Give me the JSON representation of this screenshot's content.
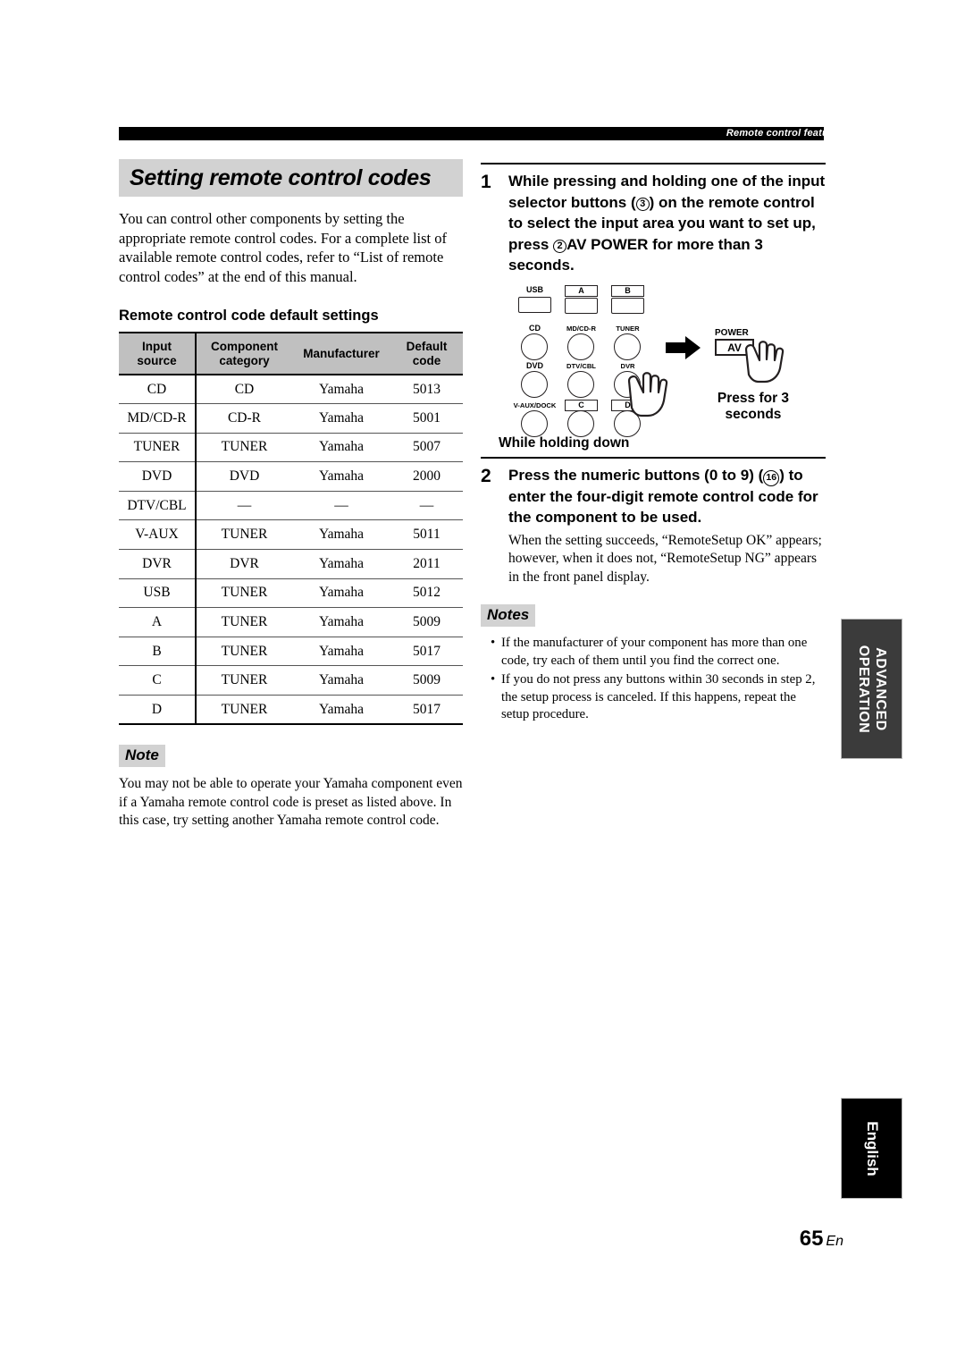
{
  "running_head": "Remote control features",
  "left": {
    "section_title": "Setting remote control codes",
    "intro": "You can control other components by setting the appropriate remote control codes. For a complete list of available remote control codes, refer to “List of remote control codes” at the end of this manual.",
    "table_heading": "Remote control code default settings",
    "table": {
      "columns": [
        {
          "line1": "Input",
          "line2": "source"
        },
        {
          "line1": "Component",
          "line2": "category"
        },
        {
          "line1": "Manufacturer",
          "line2": ""
        },
        {
          "line1": "Default",
          "line2": "code"
        }
      ],
      "rows": [
        {
          "input": "CD",
          "category": "CD",
          "manufacturer": "Yamaha",
          "code": "5013"
        },
        {
          "input": "MD/CD-R",
          "category": "CD-R",
          "manufacturer": "Yamaha",
          "code": "5001"
        },
        {
          "input": "TUNER",
          "category": "TUNER",
          "manufacturer": "Yamaha",
          "code": "5007"
        },
        {
          "input": "DVD",
          "category": "DVD",
          "manufacturer": "Yamaha",
          "code": "2000"
        },
        {
          "input": "DTV/CBL",
          "category": "—",
          "manufacturer": "—",
          "code": "—"
        },
        {
          "input": "V-AUX",
          "category": "TUNER",
          "manufacturer": "Yamaha",
          "code": "5011"
        },
        {
          "input": "DVR",
          "category": "DVR",
          "manufacturer": "Yamaha",
          "code": "2011"
        },
        {
          "input": "USB",
          "category": "TUNER",
          "manufacturer": "Yamaha",
          "code": "5012"
        },
        {
          "input": "A",
          "category": "TUNER",
          "manufacturer": "Yamaha",
          "code": "5009"
        },
        {
          "input": "B",
          "category": "TUNER",
          "manufacturer": "Yamaha",
          "code": "5017"
        },
        {
          "input": "C",
          "category": "TUNER",
          "manufacturer": "Yamaha",
          "code": "5009"
        },
        {
          "input": "D",
          "category": "TUNER",
          "manufacturer": "Yamaha",
          "code": "5017"
        }
      ]
    },
    "note": {
      "tag": "Note",
      "text": "You may not be able to operate your Yamaha component even if a Yamaha remote control code is preset as listed above. In this case, try setting another Yamaha remote control code."
    }
  },
  "right": {
    "step1": {
      "number": "1",
      "title_a": "While pressing and holding one of the input selector buttons (",
      "circ_3": "3",
      "title_b": ") on the remote control to select the input area you want to set up, press ",
      "circ_2": "2",
      "title_c": "AV POWER",
      "title_d": " for more than 3 seconds."
    },
    "diagram": {
      "row1": [
        {
          "label": "USB",
          "boxed": false
        },
        {
          "label": "A",
          "boxed": true
        },
        {
          "label": "B",
          "boxed": true
        }
      ],
      "row2": [
        "CD",
        "MD/CD-R",
        "TUNER"
      ],
      "row3": [
        "DVD",
        "DTV/CBL",
        "DVR"
      ],
      "row4": [
        {
          "label": "V-AUX/DOCK",
          "boxed": false
        },
        {
          "label": "C",
          "boxed": true
        },
        {
          "label": "D",
          "boxed": true
        }
      ],
      "caption_left": "While holding down",
      "power_label": "POWER",
      "av_label": "AV",
      "caption_right_line1": "Press for 3",
      "caption_right_line2": "seconds"
    },
    "step2": {
      "number": "2",
      "title_a": "Press the numeric buttons (0 to 9) (",
      "circ_16": "16",
      "title_b": ") to enter the four-digit remote control code for the component to be used.",
      "body": "When the setting succeeds, “RemoteSetup OK” appears; however, when it does not, “RemoteSetup NG” appears in the front panel display."
    },
    "notes": {
      "tag": "Notes",
      "items": [
        "If the manufacturer of your component has more than one code, try each of them until you find the correct one.",
        "If you do not press any buttons within 30 seconds in step 2, the setup process is canceled. If this happens, repeat the setup procedure."
      ]
    }
  },
  "side_tabs": {
    "advanced_line1": "ADVANCED",
    "advanced_line2": "OPERATION",
    "english": "English"
  },
  "folio": {
    "number": "65",
    "lang": "En"
  },
  "colors": {
    "title_bg": "#d2d2d2",
    "table_header_bg": "#c0c0c0",
    "runhead_bg": "#000000",
    "tab_advanced_bg": "#3b3b3b",
    "tab_english_bg": "#000000"
  }
}
